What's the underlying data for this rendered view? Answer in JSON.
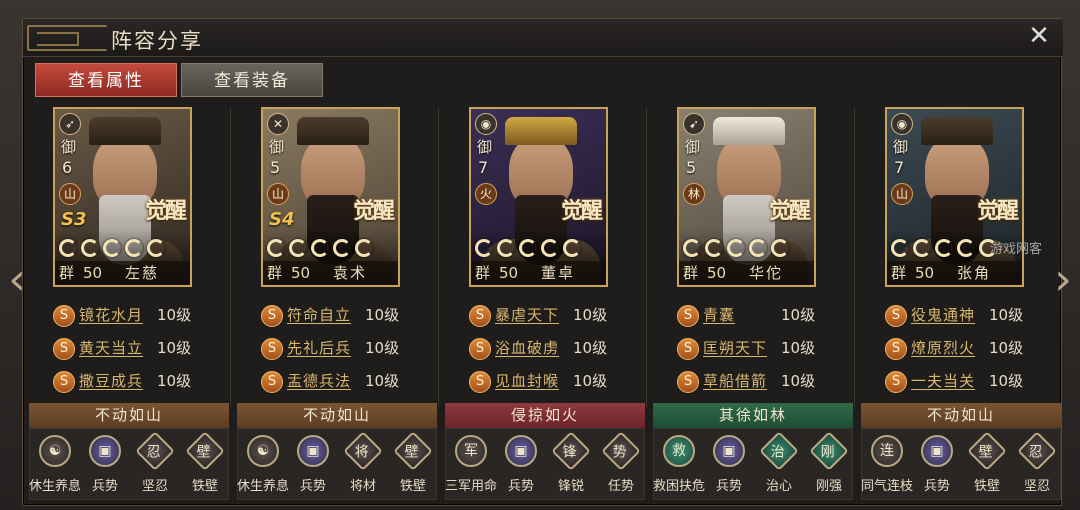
{
  "window": {
    "title": "阵容分享",
    "close_label": "✕"
  },
  "tabs": [
    {
      "label": "查看属性",
      "active": true
    },
    {
      "label": "查看装备",
      "active": false
    }
  ],
  "nav": {
    "left_arrow": "‹",
    "right_arrow": "›"
  },
  "watermark": "游戏网客",
  "generals": [
    {
      "type_icon": "bow-icon",
      "type_glyph": "➶",
      "yu": "御",
      "cost": "6",
      "terrain": "山",
      "s_badge": "S3",
      "awaken": "觉醒",
      "stars": 5,
      "faction": "群",
      "level": "50",
      "name": "左慈",
      "skills": [
        {
          "name": "镜花水月",
          "level": "10级"
        },
        {
          "name": "黄天当立",
          "level": "10级"
        },
        {
          "name": "撒豆成兵",
          "level": "10级"
        }
      ],
      "formation": {
        "label": "不动如山",
        "color": "brown"
      },
      "tactics": [
        {
          "label": "休生养息",
          "icon": "rest-icon",
          "glyph": "☯",
          "shape": "circle"
        },
        {
          "label": "兵势",
          "icon": "troop-icon",
          "glyph": "▣",
          "shape": "circle-purple"
        },
        {
          "label": "坚忍",
          "icon": "endure-icon",
          "glyph": "忍",
          "shape": "diamond"
        },
        {
          "label": "铁壁",
          "icon": "wall-icon",
          "glyph": "壁",
          "shape": "diamond"
        }
      ]
    },
    {
      "type_icon": "sword-icon",
      "type_glyph": "✕",
      "yu": "御",
      "cost": "5",
      "terrain": "山",
      "s_badge": "S4",
      "awaken": "觉醒",
      "stars": 5,
      "faction": "群",
      "level": "50",
      "name": "袁术",
      "skills": [
        {
          "name": "符命自立",
          "level": "10级"
        },
        {
          "name": "先礼后兵",
          "level": "10级"
        },
        {
          "name": "盂德兵法",
          "level": "10级"
        }
      ],
      "formation": {
        "label": "不动如山",
        "color": "brown"
      },
      "tactics": [
        {
          "label": "休生养息",
          "icon": "rest-icon",
          "glyph": "☯",
          "shape": "circle"
        },
        {
          "label": "兵势",
          "icon": "troop-icon",
          "glyph": "▣",
          "shape": "circle-purple"
        },
        {
          "label": "将材",
          "icon": "talent-icon",
          "glyph": "将",
          "shape": "diamond"
        },
        {
          "label": "铁壁",
          "icon": "wall-icon",
          "glyph": "壁",
          "shape": "diamond"
        }
      ]
    },
    {
      "type_icon": "shield-icon",
      "type_glyph": "◉",
      "yu": "御",
      "cost": "7",
      "terrain": "火",
      "s_badge": "",
      "awaken": "觉醒",
      "stars": 5,
      "faction": "群",
      "level": "50",
      "name": "董卓",
      "skills": [
        {
          "name": "暴虐天下",
          "level": "10级"
        },
        {
          "name": "浴血破虏",
          "level": "10级"
        },
        {
          "name": "见血封喉",
          "level": "10级"
        }
      ],
      "formation": {
        "label": "侵掠如火",
        "color": "red"
      },
      "tactics": [
        {
          "label": "三军用命",
          "icon": "army-icon",
          "glyph": "军",
          "shape": "circle"
        },
        {
          "label": "兵势",
          "icon": "troop-icon",
          "glyph": "▣",
          "shape": "circle-purple"
        },
        {
          "label": "锋锐",
          "icon": "blade-icon",
          "glyph": "锋",
          "shape": "diamond"
        },
        {
          "label": "任势",
          "icon": "momentum-icon",
          "glyph": "势",
          "shape": "diamond"
        }
      ]
    },
    {
      "type_icon": "spear-icon",
      "type_glyph": "➹",
      "yu": "御",
      "cost": "5",
      "terrain": "林",
      "s_badge": "",
      "awaken": "觉醒",
      "stars": 5,
      "faction": "群",
      "level": "50",
      "name": "华佗",
      "skills": [
        {
          "name": "青囊",
          "level": "10级"
        },
        {
          "name": "匡朔天下",
          "level": "10级"
        },
        {
          "name": "草船借箭",
          "level": "10级"
        }
      ],
      "formation": {
        "label": "其徐如林",
        "color": "green"
      },
      "tactics": [
        {
          "label": "救困扶危",
          "icon": "rescue-icon",
          "glyph": "救",
          "shape": "circle-teal"
        },
        {
          "label": "兵势",
          "icon": "troop-icon",
          "glyph": "▣",
          "shape": "circle-purple"
        },
        {
          "label": "治心",
          "icon": "heal-icon",
          "glyph": "治",
          "shape": "diamond-teal"
        },
        {
          "label": "刚强",
          "icon": "strong-icon",
          "glyph": "刚",
          "shape": "diamond-teal"
        }
      ]
    },
    {
      "type_icon": "shield-icon",
      "type_glyph": "◉",
      "yu": "御",
      "cost": "7",
      "terrain": "山",
      "s_badge": "",
      "awaken": "觉醒",
      "stars": 5,
      "faction": "群",
      "level": "50",
      "name": "张角",
      "skills": [
        {
          "name": "役鬼通神",
          "level": "10级"
        },
        {
          "name": "燎原烈火",
          "level": "10级"
        },
        {
          "name": "一夫当关",
          "level": "10级"
        }
      ],
      "formation": {
        "label": "不动如山",
        "color": "brown"
      },
      "tactics": [
        {
          "label": "同气连枝",
          "icon": "link-icon",
          "glyph": "连",
          "shape": "circle"
        },
        {
          "label": "兵势",
          "icon": "troop-icon",
          "glyph": "▣",
          "shape": "circle-purple"
        },
        {
          "label": "铁壁",
          "icon": "wall-icon",
          "glyph": "壁",
          "shape": "diamond"
        },
        {
          "label": "坚忍",
          "icon": "endure-icon",
          "glyph": "忍",
          "shape": "diamond"
        }
      ]
    }
  ],
  "colors": {
    "accent_red": "#c54a3c",
    "gold_border": "#c8a45a",
    "skill_text": "#d7b66e"
  }
}
